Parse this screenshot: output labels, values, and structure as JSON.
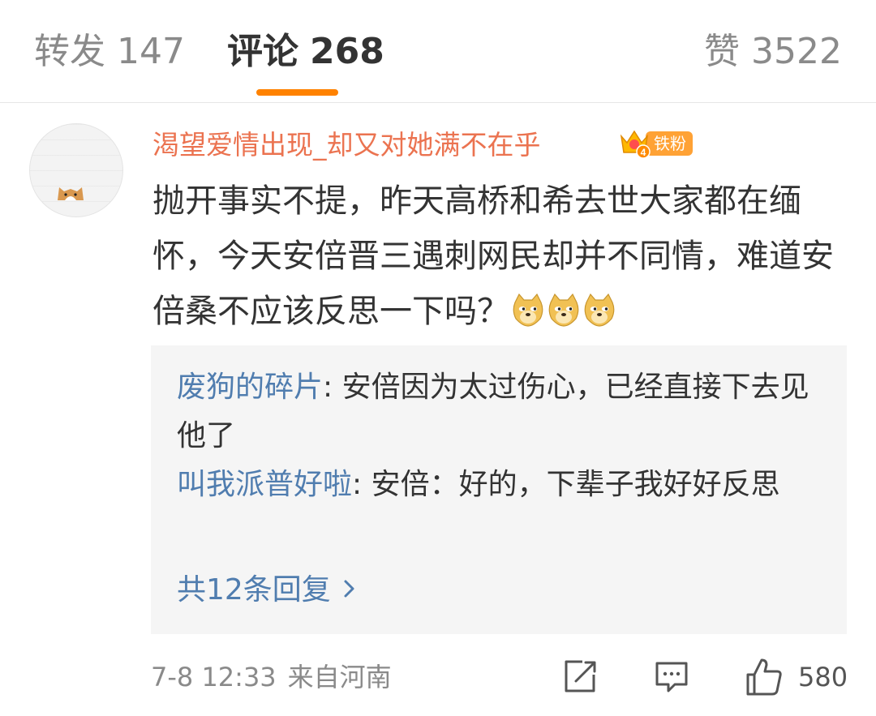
{
  "tabs": {
    "forward": {
      "label": "转发",
      "count": "147"
    },
    "comments": {
      "label": "评论",
      "count": "268"
    },
    "likes": {
      "label": "赞",
      "count": "3522"
    },
    "active_color": "#ff8200"
  },
  "comment": {
    "username": "渴望爱情出现_却又对她满不在乎",
    "badge_level": "4",
    "badge_label": "铁粉",
    "text": "抛开事实不提，昨天高桥和希去世大家都在缅怀，今天安倍晋三遇刺网民却并不同情，难道安倍桑不应该反思一下吗？",
    "emojis": [
      "doge-emoji",
      "doge-emoji",
      "doge-emoji"
    ],
    "replies": [
      {
        "author": "废狗的碎片",
        "sep": ":",
        "text": " 安倍因为太过伤心，已经直接下去见他了"
      },
      {
        "author": "叫我派普好啦",
        "sep": ":",
        "text": " 安倍：好的，下辈子我好好反思"
      }
    ],
    "more_replies": "共12条回复",
    "time": "7-8 12:33",
    "source": "来自河南",
    "like_count": "580"
  },
  "colors": {
    "username": "#eb7350",
    "link": "#507daf",
    "badge": "#ffa235",
    "reply_bg": "#f5f5f5"
  },
  "icons": {
    "repost": "repost-icon",
    "reply": "comment-icon",
    "like": "thumbs-up-icon",
    "chevron": "chevron-right-icon"
  }
}
